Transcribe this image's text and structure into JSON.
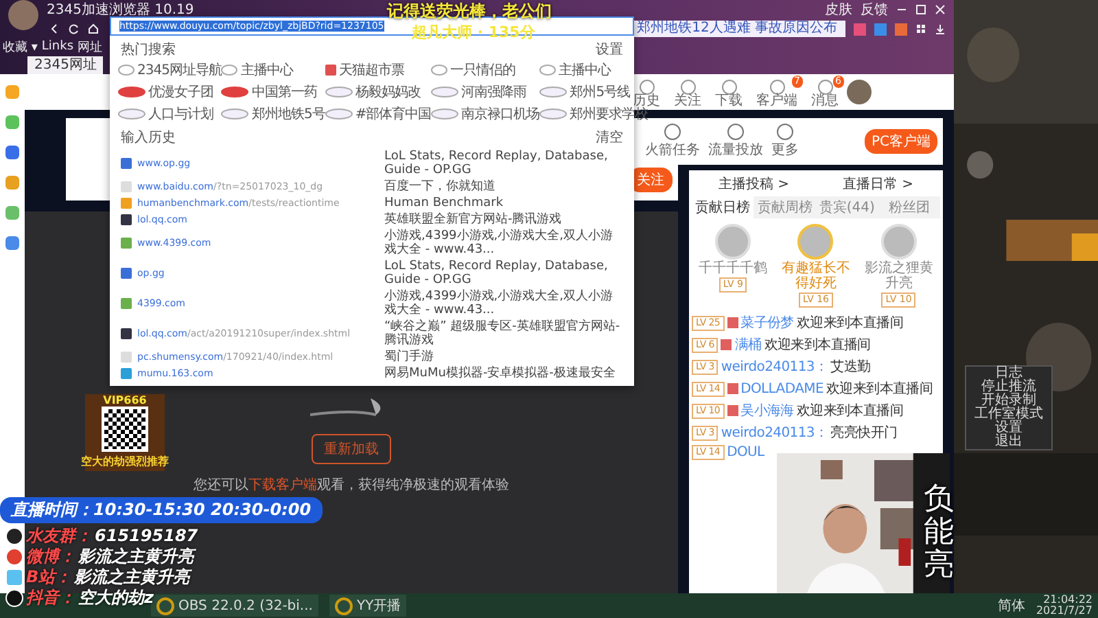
{
  "browser": {
    "title": "2345加速浏览器 10.19",
    "top_links": [
      "皮肤",
      "反馈"
    ],
    "address": "https://www.douyu.com/topic/zbyl_zbjBD?rid=1237105",
    "search_placeholder": "郑州地铁12人遇难 事故原因公布",
    "bookmarks": [
      "收藏 ▾",
      "Links",
      "网址"
    ],
    "tab": "2345网址"
  },
  "site_header": [
    {
      "label": "历史"
    },
    {
      "label": "关注"
    },
    {
      "label": "下载"
    },
    {
      "label": "客户端",
      "badge": "7"
    },
    {
      "label": "消息",
      "badge": "6"
    }
  ],
  "address_dropdown": {
    "hot_title": "热门搜索",
    "settings": "设置",
    "hot": [
      {
        "text": "2345网址导航",
        "kind": "clock"
      },
      {
        "text": "主播中心",
        "kind": "clock"
      },
      {
        "text": "天猫超市票",
        "kind": "app"
      },
      {
        "text": "一只情侣的",
        "kind": "clock"
      },
      {
        "text": "主播中心",
        "kind": "clock"
      },
      {
        "text": "优漫女子团",
        "kind": "hot"
      },
      {
        "text": "中国第一药",
        "kind": "hot"
      },
      {
        "text": "杨毅妈妈改",
        "kind": "search"
      },
      {
        "text": "河南强降雨",
        "kind": "search"
      },
      {
        "text": "郑州5号线",
        "kind": "search"
      },
      {
        "text": "人口与计划",
        "kind": "search"
      },
      {
        "text": "郑州地铁5号",
        "kind": "search"
      },
      {
        "text": "#部体育中国",
        "kind": "search"
      },
      {
        "text": "南京禄口机场",
        "kind": "search"
      },
      {
        "text": "郑州要求学校",
        "kind": "search"
      }
    ],
    "history_title": "输入历史",
    "clear": "清空",
    "history": [
      {
        "host": "www.op.gg",
        "title": "LoL Stats, Record Replay, Database, Guide - OP.GG",
        "color": "#3b6fd8"
      },
      {
        "host": "www.baidu.com",
        "path": "/?tn=25017023_10_dg",
        "title": "百度一下，你就知道",
        "color": "#dddddd"
      },
      {
        "host": "humanbenchmark.com",
        "path": "/tests/reactiontime",
        "title": "Human Benchmark",
        "color": "#f0a020"
      },
      {
        "host": "lol.qq.com",
        "title": "英雄联盟全新官方网站-腾讯游戏",
        "color": "#333344"
      },
      {
        "host": "www.4399.com",
        "title": "小游戏,4399小游戏,小游戏大全,双人小游戏大全 - www.43...",
        "color": "#6ab04c"
      },
      {
        "host": "op.gg",
        "title": "LoL Stats, Record Replay, Database, Guide - OP.GG",
        "color": "#3b6fd8"
      },
      {
        "host": "4399.com",
        "title": "小游戏,4399小游戏,小游戏大全,双人小游戏大全 - www.43...",
        "color": "#6ab04c"
      },
      {
        "host": "lol.qq.com",
        "path": "/act/a20191210super/index.shtml",
        "title": "“峡谷之巅” 超级服专区-英雄联盟官方网站-腾讯游戏",
        "color": "#333344"
      },
      {
        "host": "pc.shumensy.com",
        "path": "/170921/40/index.html",
        "title": "蜀门手游",
        "color": "#dddddd"
      },
      {
        "host": "mumu.163.com",
        "title": "网易MuMu模拟器-安卓模拟器-极速最安全",
        "color": "#2a9fd8"
      }
    ]
  },
  "room_tools": {
    "items": [
      "火箭任务",
      "流量投放",
      "更多"
    ],
    "client_button": "PC客户端",
    "follow": "关注"
  },
  "ranking": {
    "links": [
      "主播投稿 >",
      "直播日常 >"
    ],
    "tabs": [
      {
        "label": "贡献日榜",
        "selected": true
      },
      {
        "label": "贡献周榜",
        "selected": false
      },
      {
        "label": "贵宾(44)",
        "selected": false
      },
      {
        "label": "粉丝团",
        "selected": false
      }
    ],
    "top": [
      {
        "name": "千千千千鹤",
        "level": "LV 9",
        "first": false
      },
      {
        "name": "有趣猛长不得好死",
        "level": "LV 16",
        "first": true
      },
      {
        "name": "影流之狸黄升亮",
        "level": "LV 10",
        "first": false
      }
    ]
  },
  "chat": [
    {
      "level": "LV 25",
      "badge": true,
      "name": "菜子份梦",
      "msg": "欢迎来到本直播间"
    },
    {
      "level": "LV 6",
      "badge": true,
      "name": "满桶",
      "msg": "欢迎来到本直播间"
    },
    {
      "level": "LV 3",
      "badge": false,
      "name": "weirdo240113：",
      "msg": "艾迭勤"
    },
    {
      "level": "LV 14",
      "badge": true,
      "name": "DOLLADAME",
      "msg": "欢迎来到本直播间"
    },
    {
      "level": "LV 10",
      "badge": true,
      "name": "吴小海海",
      "msg": "欢迎来到本直播间"
    },
    {
      "level": "LV 3",
      "badge": false,
      "name": "weirdo240113：",
      "msg": "亮亮快开门"
    },
    {
      "level": "LV 14",
      "badge": false,
      "name": "DOUL"
    }
  ],
  "player": {
    "retry": "重新加载",
    "hint_pre": "您还可以",
    "hint_link": "下载客户端",
    "hint_post": "观看，获得纯净极速的观看体验"
  },
  "overlay": {
    "top_line": "记得送荧光棒，老公们",
    "rank_line": "超凡大师 · 135分",
    "qr_code": "VIP666",
    "qr_caption": "空大的劫强烈推荐",
    "schedule": "直播时间：10:30-15:30 20:30-0:00",
    "socials": [
      {
        "kind": "qq",
        "label": "水友群：",
        "value": "615195187"
      },
      {
        "kind": "weibo",
        "label": "微博：",
        "value": "影流之主黄升亮"
      },
      {
        "kind": "bili",
        "label": "B站：",
        "value": "影流之主黄升亮"
      },
      {
        "kind": "douyin",
        "label": "抖音：",
        "value": "空大的劫z"
      }
    ],
    "name_vertical": "负能亮"
  },
  "obs_menu": [
    "日志",
    "停止推流",
    "开始录制",
    "工作室模式",
    "设置",
    "退出"
  ],
  "taskbar": {
    "apps": [
      "OBS 22.0.2 (32-bi...",
      "YY开播"
    ],
    "time": "21:04:22",
    "date": "2021/7/27",
    "ime": "简体"
  }
}
